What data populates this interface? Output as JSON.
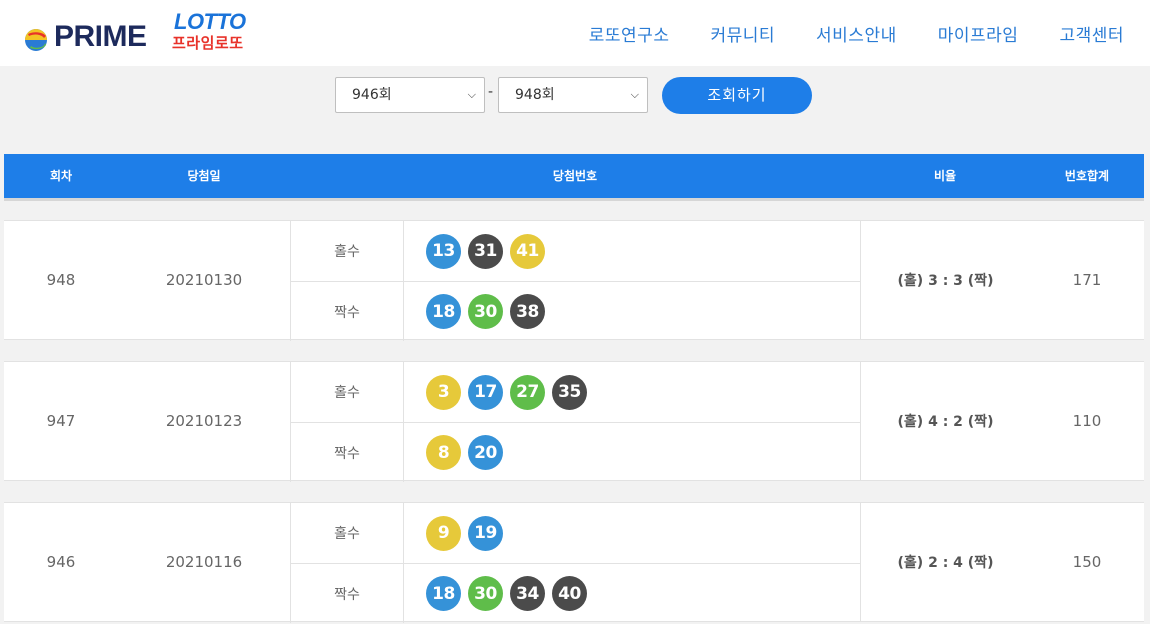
{
  "header": {
    "logo": {
      "prime": "PRIME",
      "lotto": "LOTTO",
      "korean": "프라임로또"
    },
    "nav": [
      "로또연구소",
      "커뮤니티",
      "서비스안내",
      "마이프라임",
      "고객센터"
    ]
  },
  "search": {
    "from_value": "946회",
    "to_value": "948회",
    "separator": "-",
    "button_label": "조회하기"
  },
  "table": {
    "columns": [
      "회차",
      "당첨일",
      "당첨번호",
      "비율",
      "번호합계"
    ],
    "rows": [
      {
        "round": "948",
        "date": "20210130",
        "odd_label": "홀수",
        "even_label": "짝수",
        "odd": [
          {
            "n": "13",
            "c": "b"
          },
          {
            "n": "31",
            "c": "d"
          },
          {
            "n": "41",
            "c": "y"
          }
        ],
        "even": [
          {
            "n": "18",
            "c": "b"
          },
          {
            "n": "30",
            "c": "g"
          },
          {
            "n": "38",
            "c": "d"
          }
        ],
        "ratio": "(홀) 3 : 3 (짝)",
        "sum": "171"
      },
      {
        "round": "947",
        "date": "20210123",
        "odd_label": "홀수",
        "even_label": "짝수",
        "odd": [
          {
            "n": "3",
            "c": "y"
          },
          {
            "n": "17",
            "c": "b"
          },
          {
            "n": "27",
            "c": "g"
          },
          {
            "n": "35",
            "c": "d"
          }
        ],
        "even": [
          {
            "n": "8",
            "c": "y"
          },
          {
            "n": "20",
            "c": "b"
          }
        ],
        "ratio": "(홀) 4 : 2 (짝)",
        "sum": "110"
      },
      {
        "round": "946",
        "date": "20210116",
        "odd_label": "홀수",
        "even_label": "짝수",
        "odd": [
          {
            "n": "9",
            "c": "y"
          },
          {
            "n": "19",
            "c": "b"
          }
        ],
        "even": [
          {
            "n": "18",
            "c": "b"
          },
          {
            "n": "30",
            "c": "g"
          },
          {
            "n": "34",
            "c": "d"
          },
          {
            "n": "40",
            "c": "d"
          }
        ],
        "ratio": "(홀) 2 : 4 (짝)",
        "sum": "150"
      }
    ]
  },
  "colors": {
    "accent": "#1e7ee8",
    "ball_yellow": "#e6c93a",
    "ball_blue": "#3592d8",
    "ball_dark": "#4b4b4b",
    "ball_green": "#5fbd4a"
  }
}
